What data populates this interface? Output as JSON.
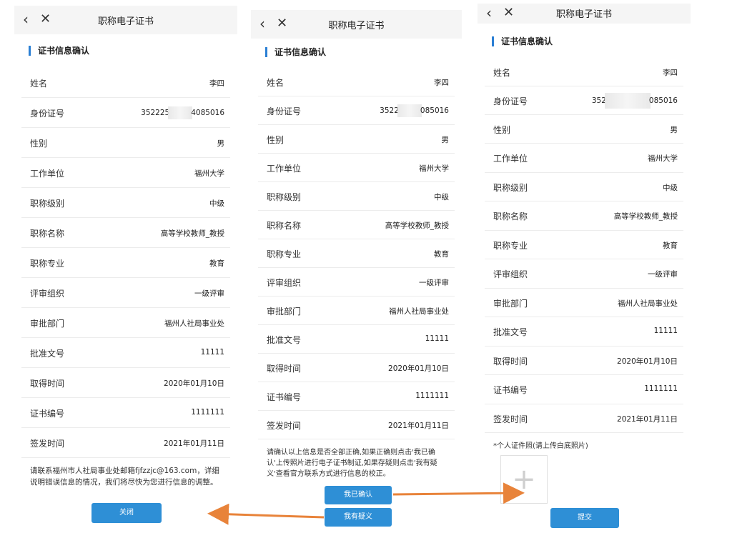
{
  "screens": [
    {
      "title": "职称电子证书",
      "section_title": "证书信息确认",
      "fields": [
        {
          "label": "姓名",
          "value": "李四"
        },
        {
          "label": "身份证号",
          "value_prefix": "352225",
          "value_suffix": "4085016"
        },
        {
          "label": "性别",
          "value": "男"
        },
        {
          "label": "工作单位",
          "value": "福州大学"
        },
        {
          "label": "职称级别",
          "value": "中级"
        },
        {
          "label": "职称名称",
          "value": "高等学校教师_教授"
        },
        {
          "label": "职称专业",
          "value": "教育"
        },
        {
          "label": "评审组织",
          "value": "一级评审"
        },
        {
          "label": "审批部门",
          "value": "福州人社局事业处"
        },
        {
          "label": "批准文号",
          "value": "11111"
        },
        {
          "label": "取得时间",
          "value": "2020年01月10日"
        },
        {
          "label": "证书编号",
          "value": "1111111"
        },
        {
          "label": "签发时间",
          "value": "2021年01月11日"
        }
      ],
      "note": "请联系福州市人社局事业处邮箱fjfzzjc@163.com，详细说明错误信息的情况，我们将尽快为您进行信息的调整。",
      "close_button": "关闭"
    },
    {
      "title": "职称电子证书",
      "section_title": "证书信息确认",
      "fields": [
        {
          "label": "姓名",
          "value": "李四"
        },
        {
          "label": "身份证号",
          "value_prefix": "3522",
          "value_suffix": "085016"
        },
        {
          "label": "性别",
          "value": "男"
        },
        {
          "label": "工作单位",
          "value": "福州大学"
        },
        {
          "label": "职称级别",
          "value": "中级"
        },
        {
          "label": "职称名称",
          "value": "高等学校教师_教授"
        },
        {
          "label": "职称专业",
          "value": "教育"
        },
        {
          "label": "评审组织",
          "value": "一级评审"
        },
        {
          "label": "审批部门",
          "value": "福州人社局事业处"
        },
        {
          "label": "批准文号",
          "value": "11111"
        },
        {
          "label": "取得时间",
          "value": "2020年01月10日"
        },
        {
          "label": "证书编号",
          "value": "1111111"
        },
        {
          "label": "签发时间",
          "value": "2021年01月11日"
        }
      ],
      "note": "请确认以上信息是否全部正确,如果正确则点击'我已确认'上传照片进行电子证书制证,如果存疑则点击'我有疑义'查看官方联系方式进行信息的校正。",
      "confirm_button": "我已确认",
      "doubt_button": "我有疑义"
    },
    {
      "title": "职称电子证书",
      "section_title": "证书信息确认",
      "fields": [
        {
          "label": "姓名",
          "value": "李四"
        },
        {
          "label": "身份证号",
          "value_prefix": "352",
          "value_suffix": "085016"
        },
        {
          "label": "性别",
          "value": "男"
        },
        {
          "label": "工作单位",
          "value": "福州大学"
        },
        {
          "label": "职称级别",
          "value": "中级"
        },
        {
          "label": "职称名称",
          "value": "高等学校教师_教授"
        },
        {
          "label": "职称专业",
          "value": "教育"
        },
        {
          "label": "评审组织",
          "value": "一级评审"
        },
        {
          "label": "审批部门",
          "value": "福州人社局事业处"
        },
        {
          "label": "批准文号",
          "value": "11111"
        },
        {
          "label": "取得时间",
          "value": "2020年01月10日"
        },
        {
          "label": "证书编号",
          "value": "1111111"
        },
        {
          "label": "签发时间",
          "value": "2021年01月11日"
        }
      ],
      "photo_label": "*个人证件照(请上传白底照片)",
      "submit_button": "提交"
    }
  ],
  "icons": {
    "back": "chevron-left-icon",
    "close": "close-icon",
    "upload": "plus-icon"
  },
  "colors": {
    "accent": "#2e8fd6",
    "arrow": "#e8833a"
  }
}
